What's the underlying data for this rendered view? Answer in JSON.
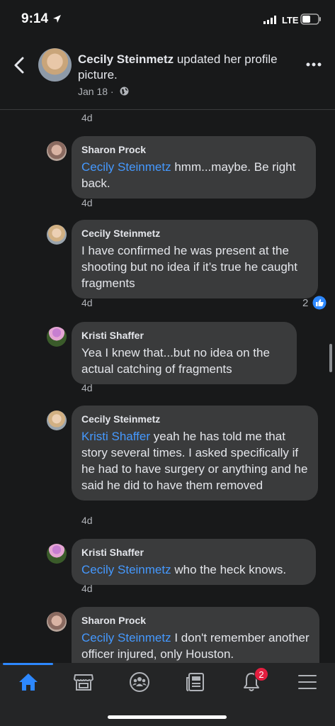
{
  "status": {
    "time": "9:14",
    "network": "LTE"
  },
  "post_header": {
    "author": "Cecily Steinmetz",
    "action": " updated her profile picture.",
    "date": "Jan 18 ·"
  },
  "feed": {
    "top_time": "4d",
    "comments": [
      {
        "author": "Sharon Prock",
        "mention": "Cecily Steinmetz",
        "text": " hmm...maybe. Be right back.",
        "time": "4d"
      },
      {
        "author": "Cecily Steinmetz",
        "mention": "",
        "text": "I have confirmed he was present at the shooting but no idea if it’s true he caught fragments",
        "time": "4d",
        "reaction_count": "2"
      },
      {
        "author": "Kristi Shaffer",
        "mention": "",
        "text": "Yea I knew that...but no idea on the actual catching of fragments",
        "time": "4d"
      },
      {
        "author": "Cecily Steinmetz",
        "mention": "Kristi Shaffer",
        "text": " yeah he has told me that story several times. I asked specifically if he had to have surgery or anything and he said he did to have them removed",
        "time": "4d"
      },
      {
        "author": "Kristi Shaffer",
        "mention": "Cecily Steinmetz",
        "text": " who the heck knows.",
        "time": "4d"
      },
      {
        "author": "Sharon Prock",
        "mention": "Cecily Steinmetz",
        "text": " I don't remember another officer injured, only Houston.",
        "time": ""
      }
    ]
  },
  "tabbar": {
    "tabs": [
      "home-icon",
      "marketplace-icon",
      "groups-icon",
      "news-icon",
      "notifications-icon",
      "menu-icon"
    ],
    "notification_badge": "2",
    "accent": "#2d88ff"
  }
}
